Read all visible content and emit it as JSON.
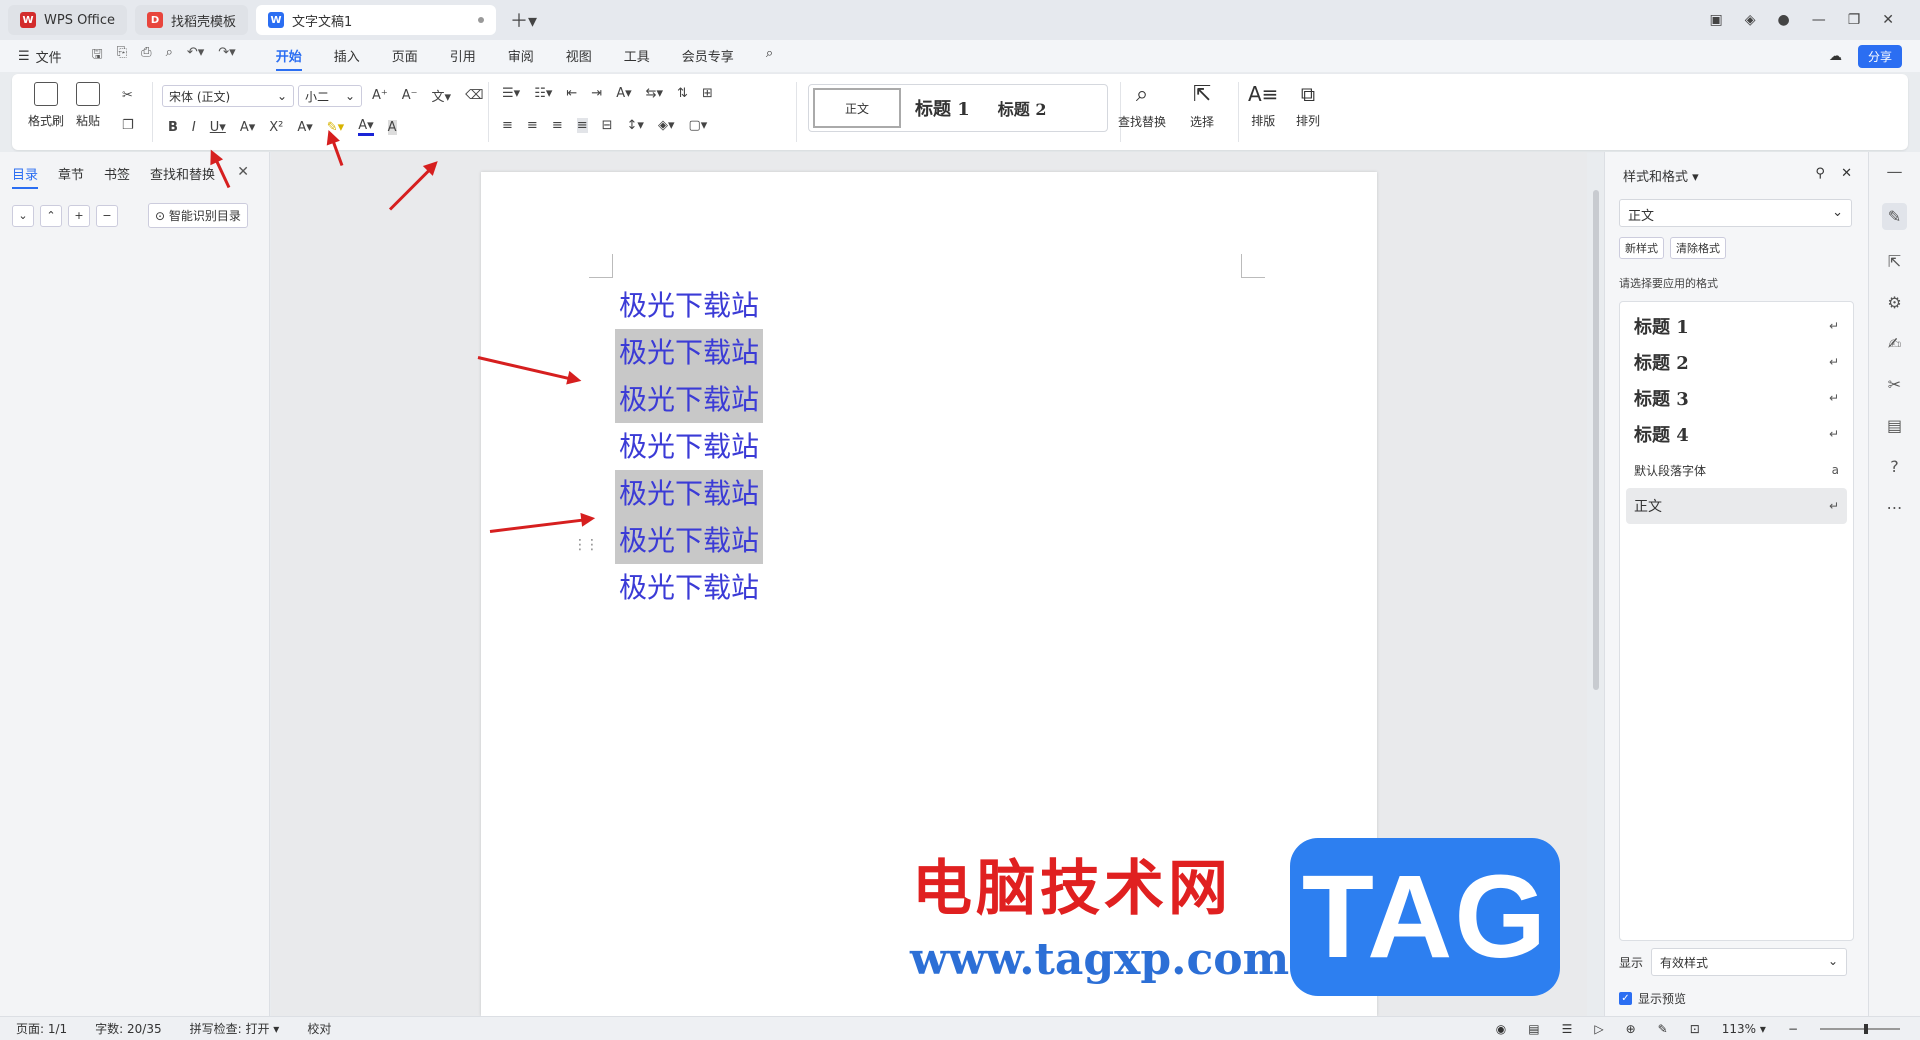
{
  "titlebar": {
    "tabs": [
      {
        "label": "WPS Office"
      },
      {
        "label": "找稻壳模板"
      },
      {
        "label": "文字文稿1"
      }
    ]
  },
  "menubar": {
    "file_label": "文件",
    "tabs": [
      "开始",
      "插入",
      "页面",
      "引用",
      "审阅",
      "视图",
      "工具",
      "会员专享"
    ],
    "active_tab": "开始",
    "share_label": "分享"
  },
  "ribbon": {
    "format_painter": "格式刷",
    "paste": "粘贴",
    "font_name": "宋体 (正文)",
    "font_size": "小二",
    "styles": {
      "body": "正文",
      "h1": "标题 1",
      "h2": "标题 2"
    },
    "find_replace": "查找替换",
    "select": "选择",
    "layout": "排版",
    "arrange": "排列",
    "font_color": "#1a24d6"
  },
  "leftpanel": {
    "tabs": [
      "目录",
      "章节",
      "书签",
      "查找和替换"
    ],
    "smart_button": "智能识别目录"
  },
  "document": {
    "lines": [
      {
        "text": "极光下载站",
        "selected": false
      },
      {
        "text": "极光下载站",
        "selected": true
      },
      {
        "text": "极光下载站",
        "selected": true
      },
      {
        "text": "极光下载站",
        "selected": false
      },
      {
        "text": "极光下载站",
        "selected": true
      },
      {
        "text": "极光下载站",
        "selected": true
      },
      {
        "text": "极光下载站",
        "selected": false
      }
    ],
    "text_color": "#3b3bd6"
  },
  "rightpanel": {
    "title": "样式和格式",
    "current_style": "正文",
    "new_style_btn": "新样式",
    "clear_format_btn": "清除格式",
    "apply_label": "请选择要应用的格式",
    "style_list": [
      {
        "label": "标题  1",
        "kind": "heading"
      },
      {
        "label": "标题  2",
        "kind": "heading"
      },
      {
        "label": "标题  3",
        "kind": "heading"
      },
      {
        "label": "标题  4",
        "kind": "heading"
      },
      {
        "label": "默认段落字体",
        "kind": "small"
      },
      {
        "label": "正文",
        "kind": "active"
      }
    ],
    "show_label": "显示",
    "show_value": "有效样式",
    "preview_label": "显示预览"
  },
  "watermark": {
    "cn_text": "电脑技术网",
    "url": "www.tagxp.com",
    "tag": "TAG"
  },
  "statusbar": {
    "page": "页面: 1/1",
    "words": "字数: 20/35",
    "spellcheck": "拼写检查: 打开",
    "proof": "校对",
    "zoom": "113%"
  }
}
